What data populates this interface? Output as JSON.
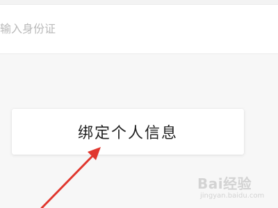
{
  "id_field": {
    "placeholder": "输入身份证"
  },
  "bind_button": {
    "label": "绑定个人信息"
  },
  "annotation": {
    "arrow_color": "#e0372e"
  },
  "watermark": {
    "logo_text": "Bai经验",
    "url_text": "jingyan.baidu.com"
  }
}
